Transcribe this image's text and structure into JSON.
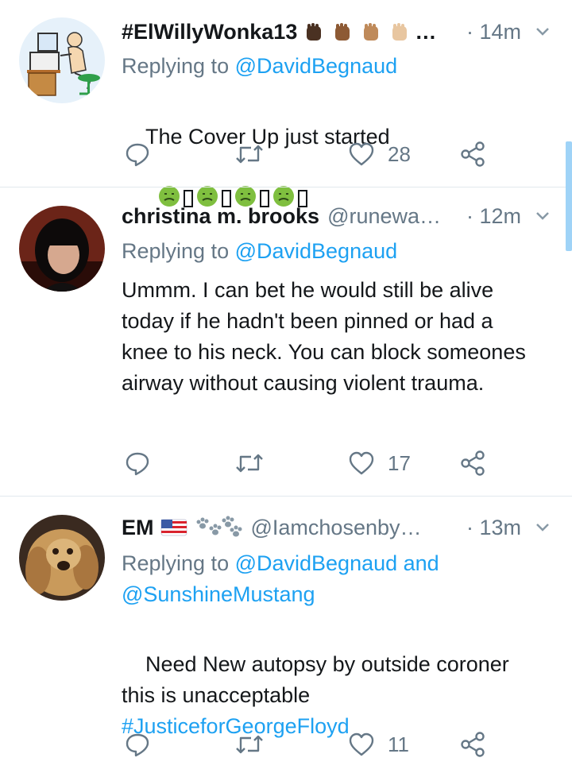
{
  "tweets": [
    {
      "name": "#ElWillyWonka13",
      "name_suffix": "…",
      "handle": "",
      "time": "· 14m",
      "replying_prefix": "Replying to ",
      "replying_to": [
        "@DavidBegnaud"
      ],
      "text": "The Cover Up just started",
      "reply_count": "",
      "retweet_count": "",
      "like_count": "28"
    },
    {
      "name": "christina m. brooks",
      "handle": "@runewa…",
      "time": "· 12m",
      "replying_prefix": "Replying to ",
      "replying_to": [
        "@DavidBegnaud"
      ],
      "text": "Ummm. I can bet he would still be alive today if he hadn't been pinned or had a knee to his neck. You can block someones airway without causing violent trauma.",
      "reply_count": "",
      "retweet_count": "",
      "like_count": "17"
    },
    {
      "name": "EM",
      "handle": "@Iamchosenby…",
      "time": "· 13m",
      "replying_prefix": "Replying to ",
      "replying_to": [
        "@DavidBegnaud",
        "@SunshineMustang"
      ],
      "replying_joiner": " and",
      "text": "Need New autopsy by outside coroner this is unacceptable",
      "hashtag": "#JusticeforGeorgeFloyd",
      "reply_count": "",
      "retweet_count": "",
      "like_count": "11"
    }
  ],
  "icons": {
    "reply": "reply-icon",
    "retweet": "retweet-icon",
    "like": "heart-icon",
    "share": "share-icon",
    "more": "chevron-down-icon"
  },
  "colors": {
    "accent": "#1da1f2",
    "secondary_text": "#657786",
    "divider": "#e1e8ed"
  }
}
